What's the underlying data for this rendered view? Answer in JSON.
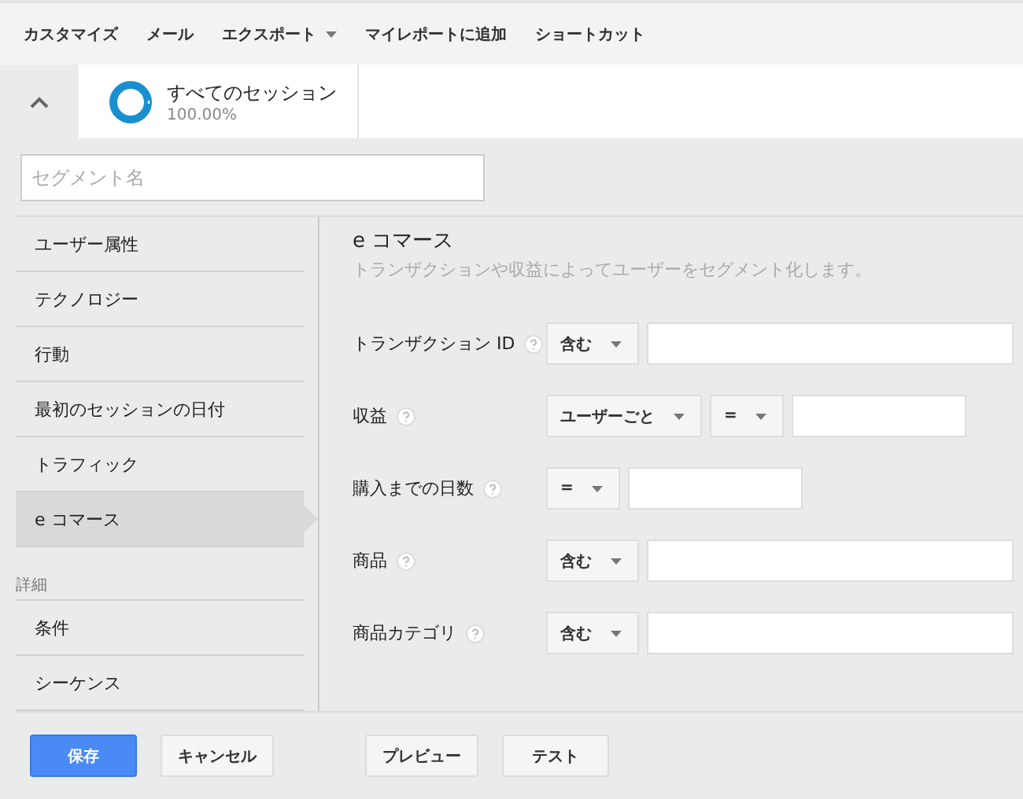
{
  "toolbar": [
    {
      "label": "カスタマイズ",
      "dropdown": false
    },
    {
      "label": "メール",
      "dropdown": false
    },
    {
      "label": "エクスポート",
      "dropdown": true
    },
    {
      "label": "マイレポートに追加",
      "dropdown": false
    },
    {
      "label": "ショートカット",
      "dropdown": false
    }
  ],
  "segment": {
    "name": "すべてのセッション",
    "percent": "100.00%"
  },
  "segment_name": {
    "placeholder": "セグメント名"
  },
  "sidebar": {
    "items": [
      {
        "label": "ユーザー属性",
        "selected": false
      },
      {
        "label": "テクノロジー",
        "selected": false
      },
      {
        "label": "行動",
        "selected": false
      },
      {
        "label": "最初のセッションの日付",
        "selected": false
      },
      {
        "label": "トラフィック",
        "selected": false
      },
      {
        "label": "e コマース",
        "selected": true
      }
    ],
    "advanced_heading": "詳細",
    "advanced_items": [
      {
        "label": "条件",
        "selected": false
      },
      {
        "label": "シーケンス",
        "selected": false
      }
    ]
  },
  "panel": {
    "title": "e コマース",
    "description": "トランザクションや収益によってユーザーをセグメント化します。",
    "rows": [
      {
        "label": "トランザクション ID",
        "selects": [
          "含む"
        ],
        "kind": "text"
      },
      {
        "label": "収益",
        "selects": [
          "ユーザーごと",
          "="
        ],
        "kind": "number"
      },
      {
        "label": "購入までの日数",
        "selects": [
          "="
        ],
        "kind": "number"
      },
      {
        "label": "商品",
        "selects": [
          "含む"
        ],
        "kind": "text"
      },
      {
        "label": "商品カテゴリ",
        "selects": [
          "含む"
        ],
        "kind": "text"
      }
    ]
  },
  "footer": {
    "buttons": [
      {
        "label": "保存",
        "kind": "primary"
      },
      {
        "label": "キャンセル",
        "kind": "normal"
      },
      {
        "label": "プレビュー",
        "kind": "spaced"
      },
      {
        "label": "テスト",
        "kind": "normal"
      }
    ]
  }
}
